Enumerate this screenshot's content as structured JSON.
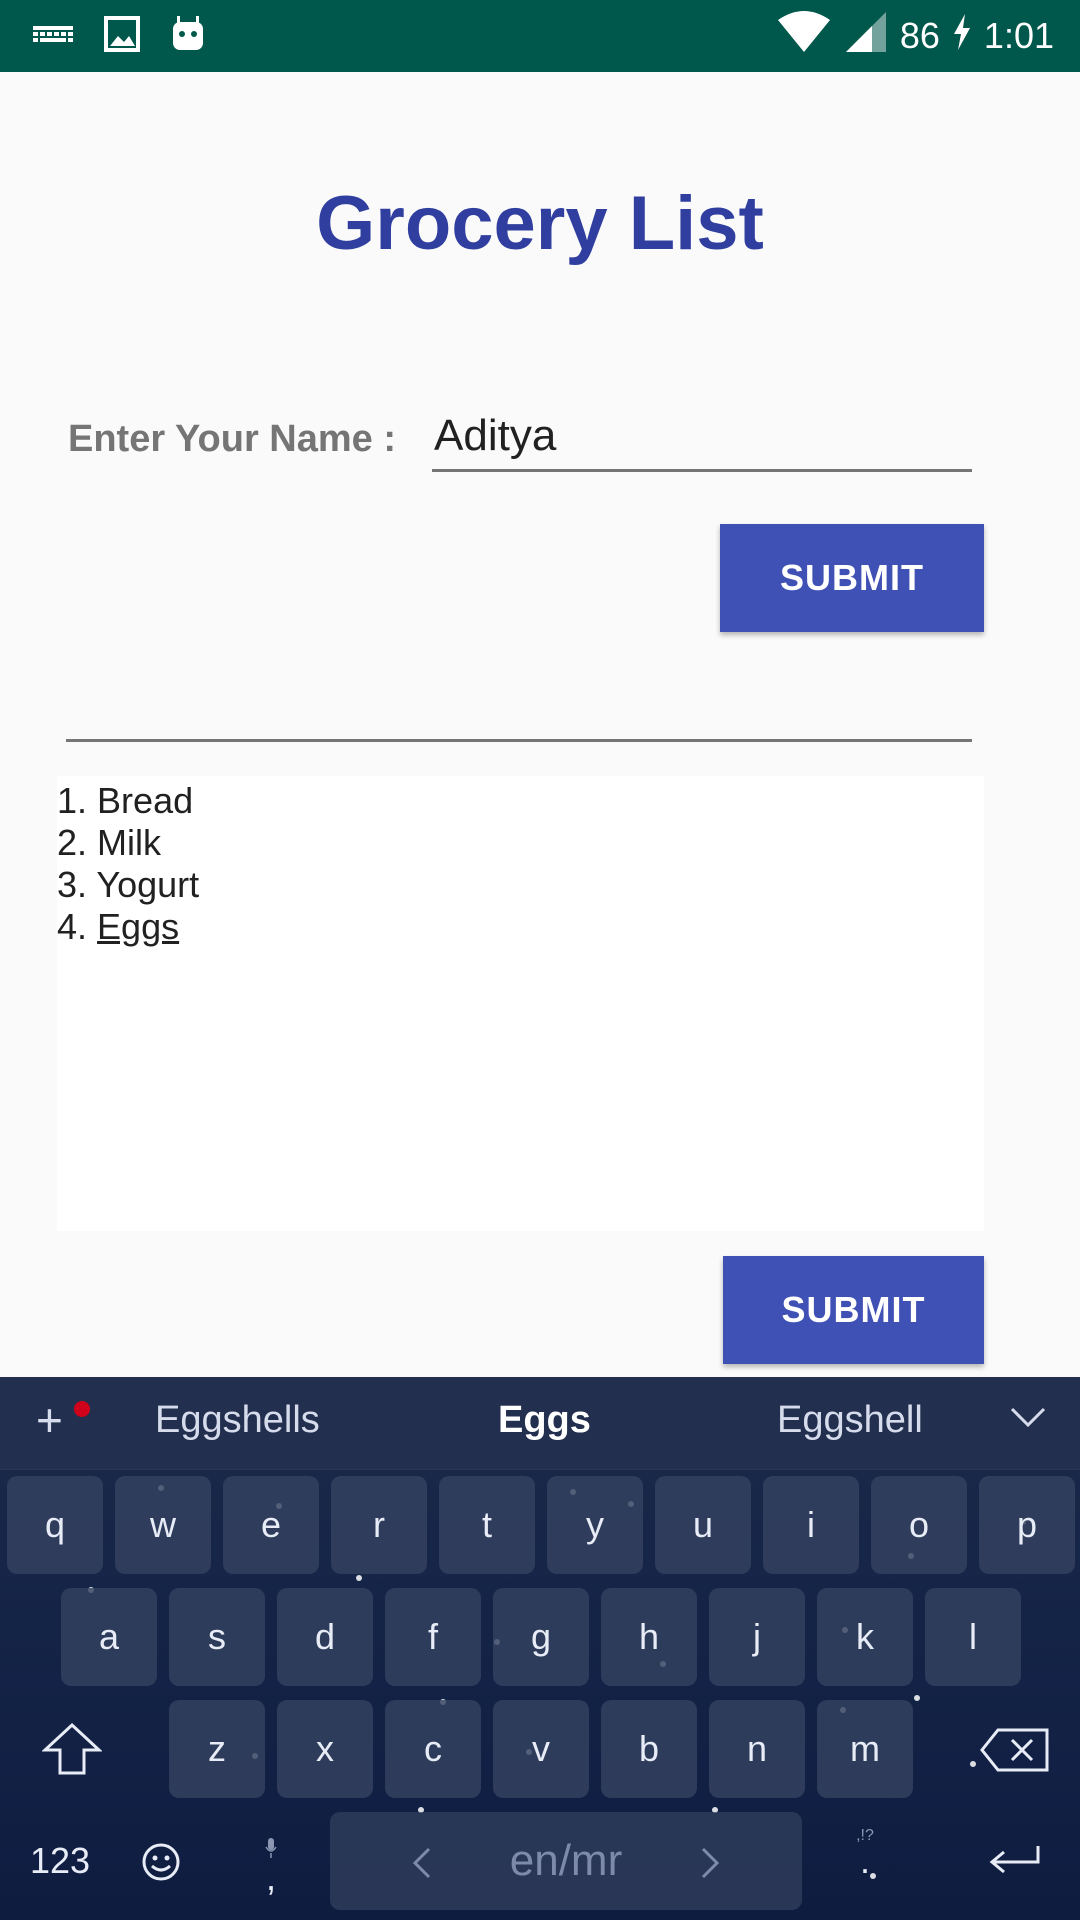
{
  "status_bar": {
    "icons_left": [
      "keyboard-icon",
      "image-icon",
      "android-icon"
    ],
    "icons_right": [
      "wifi-icon",
      "signal-icon",
      "battery-charging-icon"
    ],
    "battery": "86",
    "time": "1:01",
    "background_color": "#00574b"
  },
  "title": "Grocery List",
  "name_form": {
    "label": "Enter Your Name :",
    "value": "Aditya",
    "submit_label": "SUBMIT"
  },
  "list_form": {
    "item_value": "",
    "items": [
      {
        "number": "1.",
        "text": "Bread"
      },
      {
        "number": "2.",
        "text": "Milk"
      },
      {
        "number": "3.",
        "text": "Yogurt"
      },
      {
        "number": "4.",
        "text": "Eggs"
      }
    ],
    "submit_label": "SUBMIT"
  },
  "colors": {
    "title": "#303f9f",
    "button": "#3f51b5",
    "label": "#757575"
  },
  "keyboard": {
    "suggestions": [
      "Eggshells",
      "Eggs",
      "Eggshell"
    ],
    "row1": [
      "q",
      "w",
      "e",
      "r",
      "t",
      "y",
      "u",
      "i",
      "o",
      "p"
    ],
    "row2": [
      "a",
      "s",
      "d",
      "f",
      "g",
      "h",
      "j",
      "k",
      "l"
    ],
    "row3": [
      "z",
      "x",
      "c",
      "v",
      "b",
      "n",
      "m"
    ],
    "numbers_key": "123",
    "comma_key": ",",
    "space_label": "en/mr",
    "period_key": ".",
    "period_hint": ",!?"
  }
}
